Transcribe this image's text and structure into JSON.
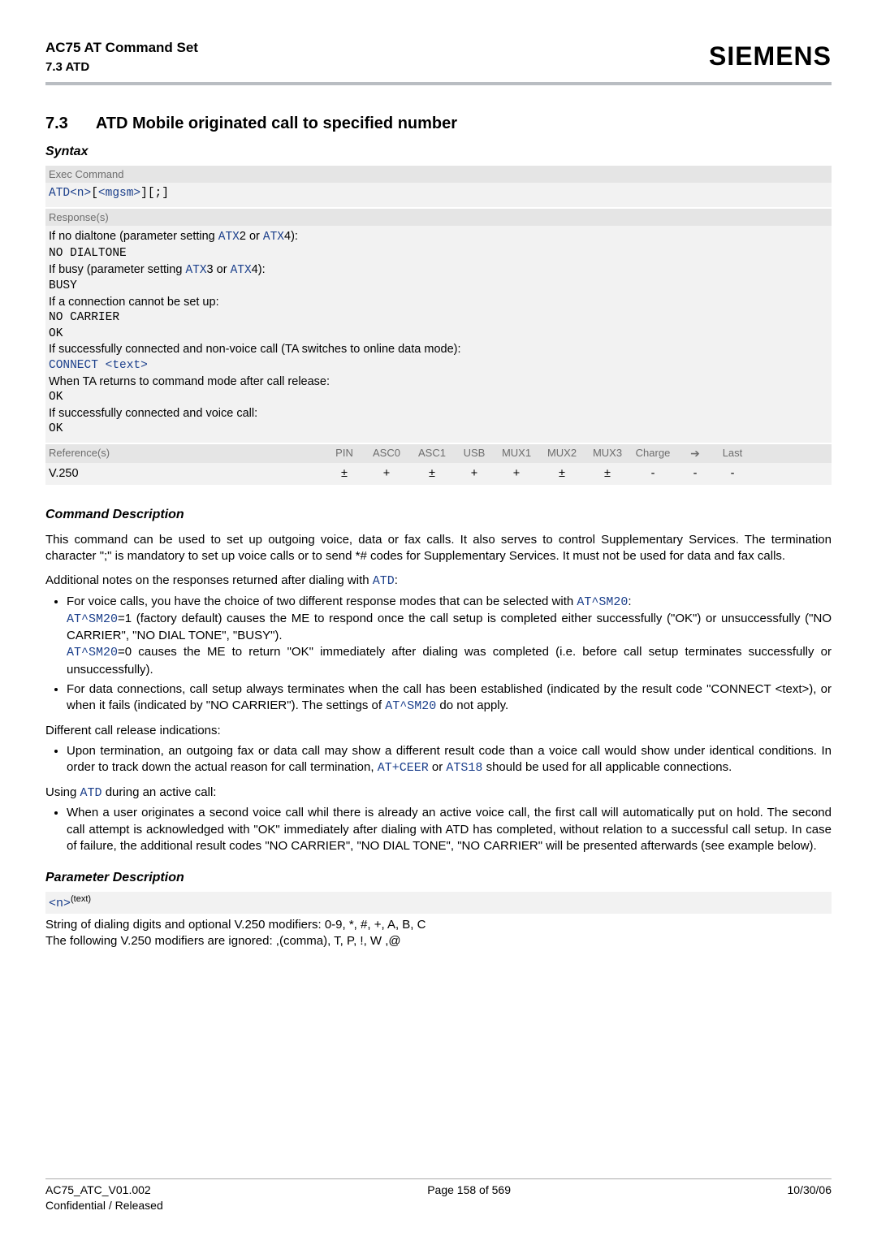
{
  "header": {
    "doc_title": "AC75 AT Command Set",
    "doc_sub": "7.3 ATD",
    "brand": "SIEMENS"
  },
  "section": {
    "num": "7.3",
    "title": "ATD   Mobile originated call to specified number"
  },
  "syntax": {
    "heading": "Syntax",
    "exec_label": "Exec Command",
    "exec_cmd_1": "ATD",
    "exec_cmd_n": "<n>",
    "exec_cmd_br1": "[",
    "exec_cmd_m": "<mgsm>",
    "exec_cmd_br2": "][;]",
    "response_label": "Response(s)",
    "r1a": "If no dialtone (parameter setting ",
    "r1b": "2 or ",
    "r1c": "4):",
    "r2": "NO DIALTONE",
    "r3a": "If busy (parameter setting ",
    "r3b": "3 or ",
    "r3c": "4):",
    "r4": "BUSY",
    "r5": "If a connection cannot be set up:",
    "r6": "NO CARRIER",
    "r7": "OK",
    "r8": "If successfully connected and non-voice call (TA switches to online data mode):",
    "r9a": "CONNECT ",
    "r9b": "<text>",
    "r10": "When TA returns to command mode after call release:",
    "r11": "OK",
    "r12": "If successfully connected and voice call:",
    "r13": "OK",
    "link_atx": "ATX"
  },
  "refs": {
    "label": "Reference(s)",
    "cols": [
      "PIN",
      "ASC0",
      "ASC1",
      "USB",
      "MUX1",
      "MUX2",
      "MUX3",
      "Charge",
      "➔",
      "Last"
    ],
    "row_label": "V.250",
    "vals": [
      "±",
      "+",
      "±",
      "+",
      "+",
      "±",
      "±",
      "-",
      "-",
      "-"
    ]
  },
  "cmd_desc": {
    "heading": "Command Description",
    "p1": "This command can be used to set up outgoing voice, data or fax calls. It also serves to control Supplementary Services. The termination character \";\" is mandatory to set up voice calls or to send *# codes for Supplementary Services. It must not be used for data and fax calls.",
    "p2a": "Additional notes on the responses returned after dialing with ",
    "p2b": ":",
    "link_atd": "ATD",
    "b1a": "For voice calls, you have the choice of two different response modes that can be selected with ",
    "b1b": ": ",
    "b1c": "=1 (factory default) causes the ME to respond once the call setup is completed either successfully (\"OK\") or unsuccessfully (\"NO CARRIER\", \"NO DIAL TONE\", \"BUSY\").",
    "b1d": "=0 causes the ME to return \"OK\" immediately after dialing was completed (i.e. before call setup terminates successfully or unsuccessfully).",
    "link_sm20": "AT^SM20",
    "b2a": "For data connections, call setup always terminates when the call has been established (indicated by the result code \"CONNECT <text>), or when it fails (indicated by \"NO CARRIER\"). The settings of ",
    "b2b": " do not apply.",
    "p3": "Different call release indications:",
    "b3a": "Upon termination, an outgoing fax or data call may show a different result code than a voice call would show under identical conditions. In order to track down the actual reason for call termination, ",
    "b3b": " or ",
    "b3c": " should be used for all applicable connections.",
    "link_ceer": "AT+CEER",
    "link_ats18": "ATS18",
    "p4a": "Using ",
    "p4b": " during an active call:",
    "b4": "When a user originates a second voice call whil there is already an active voice call, the first call will automatically put on hold. The second call attempt is acknowledged with \"OK\" immediately after dialing with ATD has completed, without relation to a successful call setup. In case of failure, the additional result codes \"NO CARRIER\", \"NO DIAL TONE\", \"NO CARRIER\" will be presented afterwards (see example below)."
  },
  "param": {
    "heading": "Parameter Description",
    "name": "<n>",
    "type": "(text)",
    "l1": "String of dialing digits and optional V.250 modifiers: 0-9, *, #, +, A, B, C",
    "l2": "The following V.250 modifiers are ignored: ,(comma), T, P, !, W ,@"
  },
  "footer": {
    "left": "AC75_ATC_V01.002",
    "center": "Page 158 of 569",
    "right": "10/30/06",
    "left2": "Confidential / Released"
  }
}
